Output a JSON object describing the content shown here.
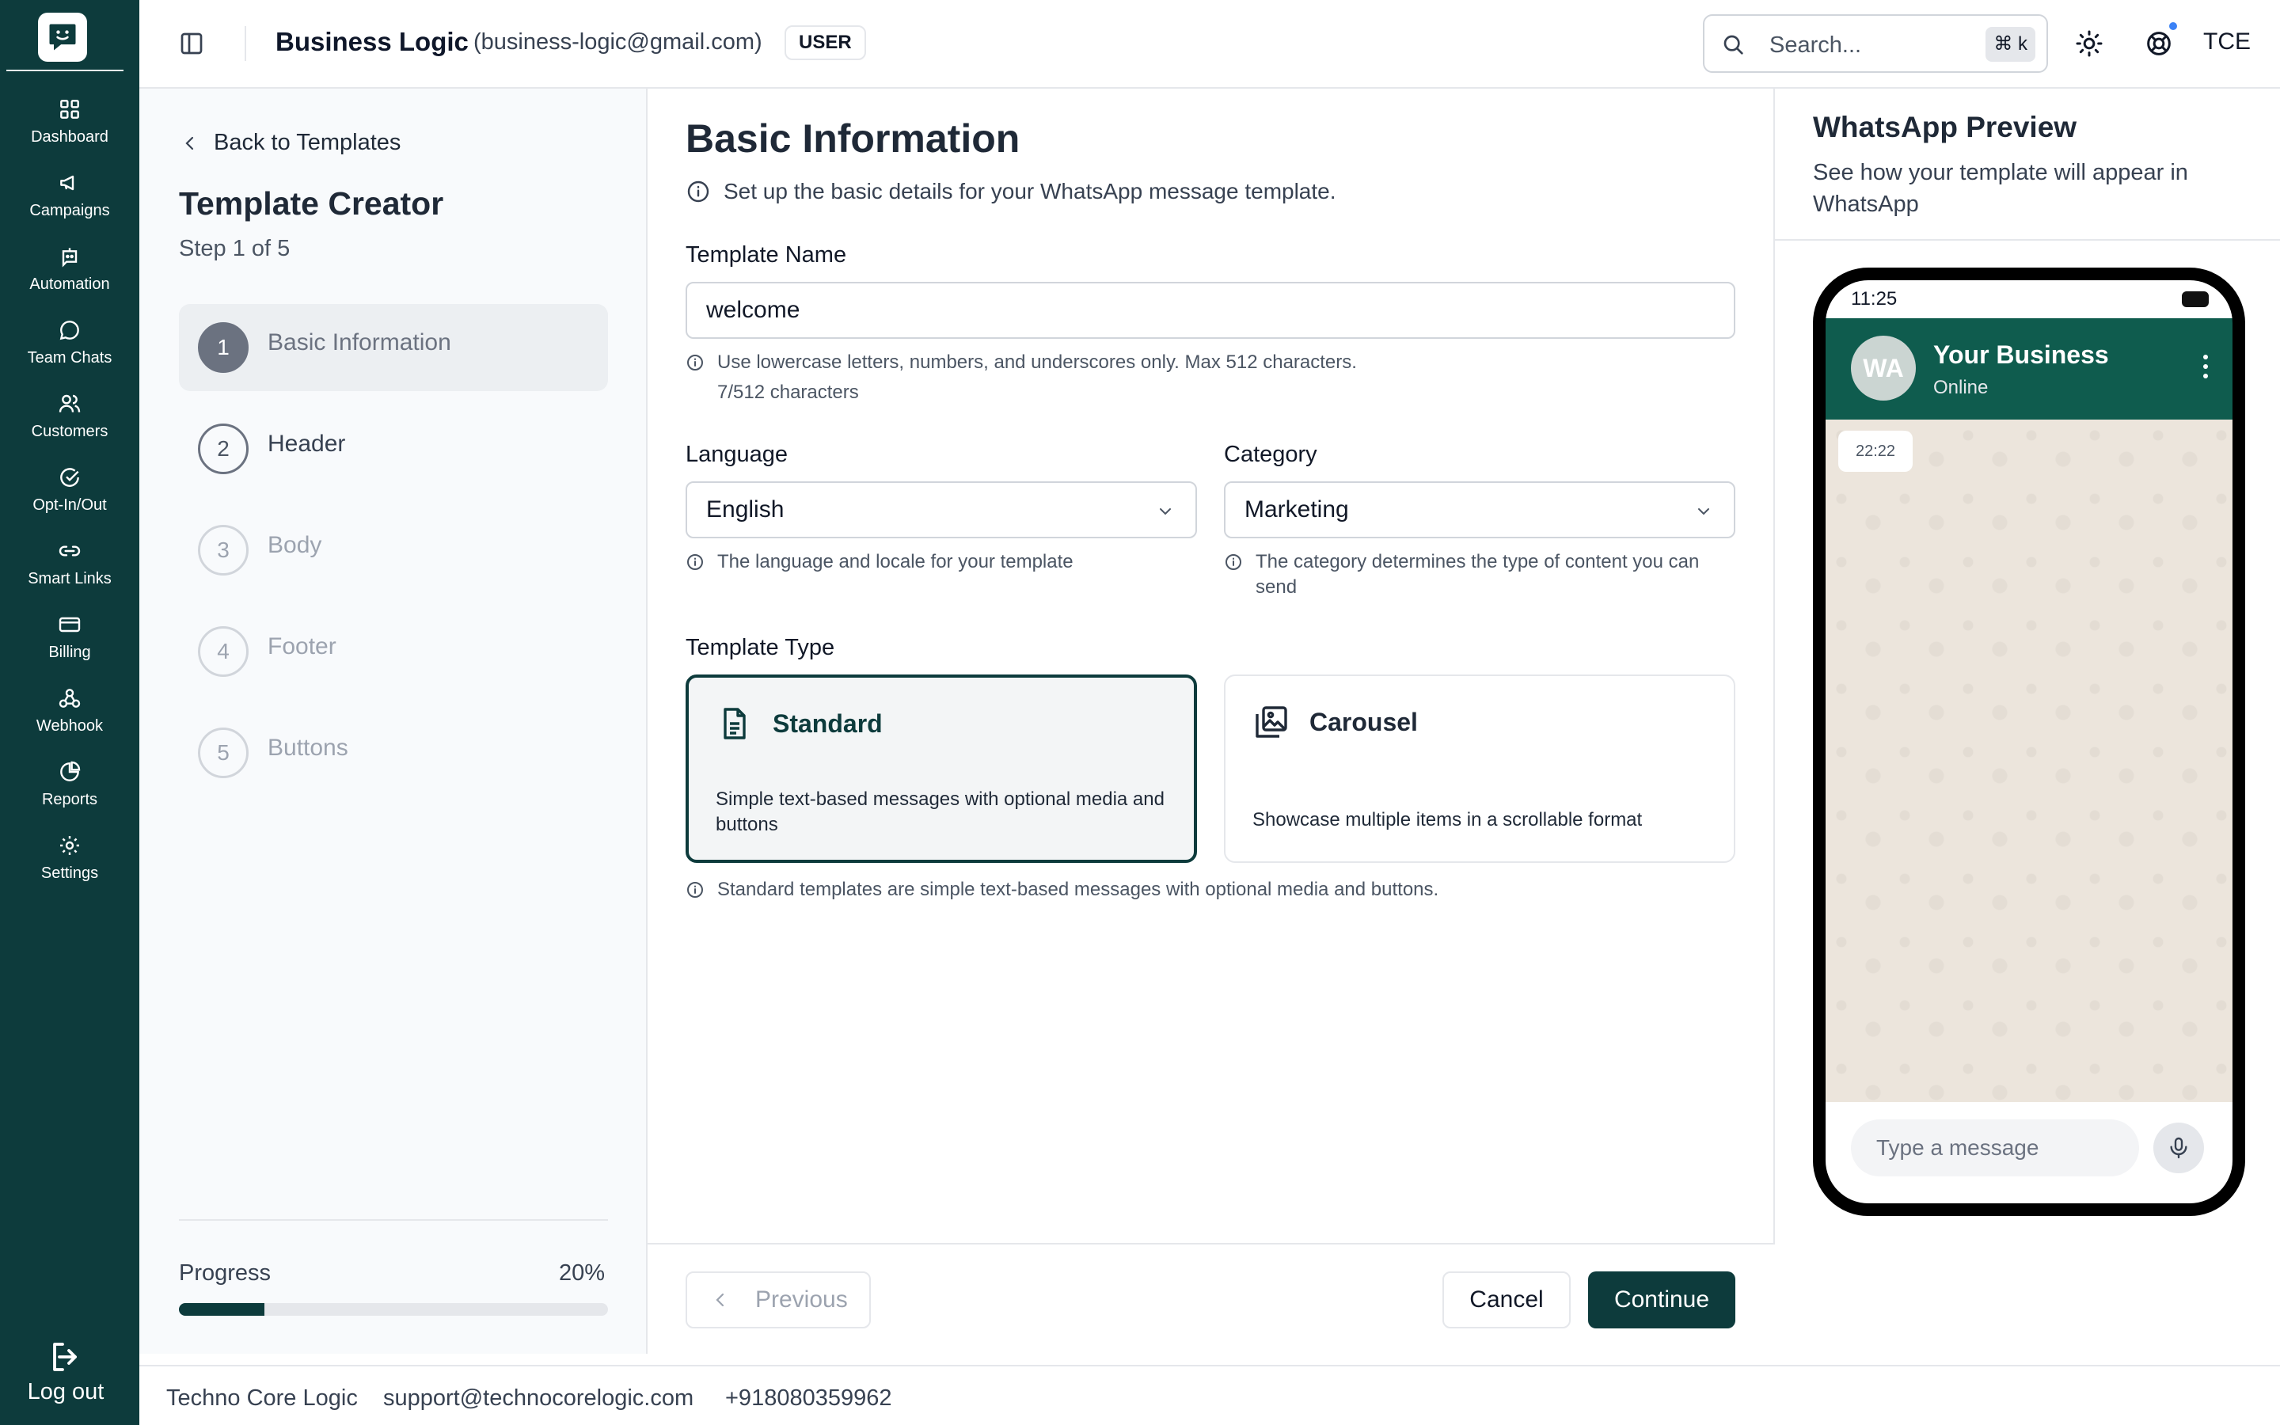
{
  "sidebar": {
    "items": [
      {
        "label": "Dashboard",
        "icon": "dashboard-icon"
      },
      {
        "label": "Campaigns",
        "icon": "megaphone-icon"
      },
      {
        "label": "Automation",
        "icon": "bot-icon"
      },
      {
        "label": "Team Chats",
        "icon": "chat-bubble-icon"
      },
      {
        "label": "Customers",
        "icon": "users-icon"
      },
      {
        "label": "Opt-In/Out",
        "icon": "check-circle-icon"
      },
      {
        "label": "Smart Links",
        "icon": "link-icon"
      },
      {
        "label": "Billing",
        "icon": "credit-card-icon"
      },
      {
        "label": "Webhook",
        "icon": "webhook-icon"
      },
      {
        "label": "Reports",
        "icon": "pie-chart-icon"
      },
      {
        "label": "Settings",
        "icon": "gear-icon"
      }
    ],
    "logout_label": "Log out"
  },
  "header": {
    "business_name": "Business Logic",
    "business_email": "(business-logic@gmail.com)",
    "role": "USER",
    "search_placeholder": "Search...",
    "shortcut": "⌘ k",
    "avatar_initials": "TCE"
  },
  "steps_panel": {
    "back_label": "Back to Templates",
    "title": "Template Creator",
    "step_indicator": "Step 1 of 5",
    "steps": [
      {
        "num": "1",
        "label": "Basic Information"
      },
      {
        "num": "2",
        "label": "Header"
      },
      {
        "num": "3",
        "label": "Body"
      },
      {
        "num": "4",
        "label": "Footer"
      },
      {
        "num": "5",
        "label": "Buttons"
      }
    ],
    "progress_label": "Progress",
    "progress_text": "20%",
    "progress_value": 0.2
  },
  "form": {
    "title": "Basic Information",
    "description": "Set up the basic details for your WhatsApp message template.",
    "template_name_label": "Template Name",
    "template_name_value": "welcome",
    "template_name_hint": "Use lowercase letters, numbers, and underscores only. Max 512 characters.",
    "char_count": "7/512 characters",
    "language_label": "Language",
    "language_value": "English",
    "language_hint": "The language and locale for your template",
    "category_label": "Category",
    "category_value": "Marketing",
    "category_hint": "The category determines the type of content you can send",
    "template_type_label": "Template Type",
    "types": [
      {
        "name": "Standard",
        "desc": "Simple text-based messages with optional media and buttons",
        "selected": true
      },
      {
        "name": "Carousel",
        "desc": "Showcase multiple items in a scrollable format",
        "selected": false
      }
    ],
    "type_hint": "Standard templates are simple text-based messages with optional media and buttons.",
    "previous_label": "Previous",
    "cancel_label": "Cancel",
    "continue_label": "Continue"
  },
  "preview": {
    "title": "WhatsApp Preview",
    "description": "See how your template will appear in WhatsApp",
    "status_time": "11:25",
    "avatar": "WA",
    "business_name": "Your Business",
    "business_status": "Online",
    "message_time": "22:22",
    "input_placeholder": "Type a message"
  },
  "footer": {
    "company": "Techno Core Logic",
    "email": "support@technocorelogic.com",
    "phone": "+918080359962"
  },
  "colors": {
    "brand": "#0d3b3c",
    "whatsapp_header": "#0f5c4e",
    "notification_dot": "#3b82f6"
  }
}
